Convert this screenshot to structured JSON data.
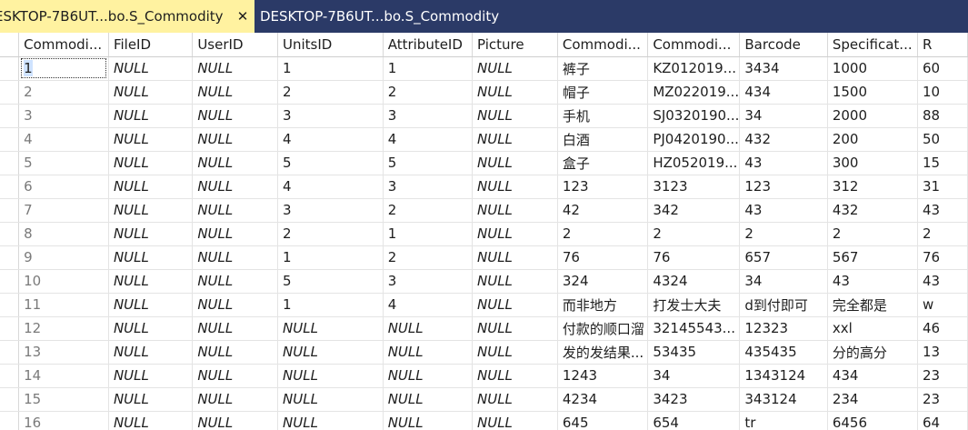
{
  "tabs": [
    {
      "label": "ESKTOP-7B6UT...bo.S_Commodity",
      "active": true,
      "close": "✕"
    },
    {
      "label": "DESKTOP-7B6UT...bo.S_Commodity",
      "active": false
    }
  ],
  "colors": {
    "tabbar_bg": "#2b3a67",
    "active_tab_bg": "#fff2a0",
    "selected_cell_bg": "#cfe3ff"
  },
  "grid": {
    "columns": [
      "Commodi...",
      "FileID",
      "UserID",
      "UnitsID",
      "AttributeID",
      "Picture",
      "Commodi...",
      "Commodi...",
      "Barcode",
      "Specificat...",
      "R"
    ],
    "rows": [
      {
        "cells": [
          "1",
          "NULL",
          "NULL",
          "1",
          "1",
          "NULL",
          "裤子",
          "KZ012019...",
          "3434",
          "1000",
          "60"
        ]
      },
      {
        "cells": [
          "2",
          "NULL",
          "NULL",
          "2",
          "2",
          "NULL",
          "帽子",
          "MZ022019...",
          "434",
          "1500",
          "10"
        ]
      },
      {
        "cells": [
          "3",
          "NULL",
          "NULL",
          "3",
          "3",
          "NULL",
          "手机",
          "SJ0320190...",
          "34",
          "2000",
          "88"
        ]
      },
      {
        "cells": [
          "4",
          "NULL",
          "NULL",
          "4",
          "4",
          "NULL",
          "白酒",
          "PJ0420190...",
          "432",
          "200",
          "50"
        ]
      },
      {
        "cells": [
          "5",
          "NULL",
          "NULL",
          "5",
          "5",
          "NULL",
          "盒子",
          "HZ052019...",
          "43",
          "300",
          "15"
        ]
      },
      {
        "cells": [
          "6",
          "NULL",
          "NULL",
          "4",
          "3",
          "NULL",
          "123",
          "3123",
          "123",
          "312",
          "31"
        ]
      },
      {
        "cells": [
          "7",
          "NULL",
          "NULL",
          "3",
          "2",
          "NULL",
          "42",
          "342",
          "43",
          "432",
          "43"
        ]
      },
      {
        "cells": [
          "8",
          "NULL",
          "NULL",
          "2",
          "1",
          "NULL",
          "2",
          "2",
          "2",
          "2",
          "2"
        ]
      },
      {
        "cells": [
          "9",
          "NULL",
          "NULL",
          "1",
          "2",
          "NULL",
          "76",
          "76",
          "657",
          "567",
          "76"
        ]
      },
      {
        "cells": [
          "10",
          "NULL",
          "NULL",
          "5",
          "3",
          "NULL",
          "324",
          "4324",
          "34",
          "43",
          "43"
        ]
      },
      {
        "cells": [
          "11",
          "NULL",
          "NULL",
          "1",
          "4",
          "NULL",
          "而非地方",
          "打发士大夫",
          "d到付即可",
          "完全都是",
          "w"
        ]
      },
      {
        "cells": [
          "12",
          "NULL",
          "NULL",
          "NULL",
          "NULL",
          "NULL",
          "付款的顺口溜",
          "32145543...",
          "12323",
          "xxl",
          "46"
        ]
      },
      {
        "cells": [
          "13",
          "NULL",
          "NULL",
          "NULL",
          "NULL",
          "NULL",
          "发的发结果...",
          "53435",
          "435435",
          "分的高分",
          "13"
        ]
      },
      {
        "cells": [
          "14",
          "NULL",
          "NULL",
          "NULL",
          "NULL",
          "NULL",
          "1243",
          "34",
          "1343124",
          "434",
          "23"
        ]
      },
      {
        "cells": [
          "15",
          "NULL",
          "NULL",
          "NULL",
          "NULL",
          "NULL",
          "4234",
          "3423",
          "343124",
          "234",
          "23"
        ]
      },
      {
        "cells": [
          "16",
          "NULL",
          "NULL",
          "NULL",
          "NULL",
          "NULL",
          "645",
          "654",
          "tr",
          "6456",
          "64"
        ]
      }
    ]
  }
}
